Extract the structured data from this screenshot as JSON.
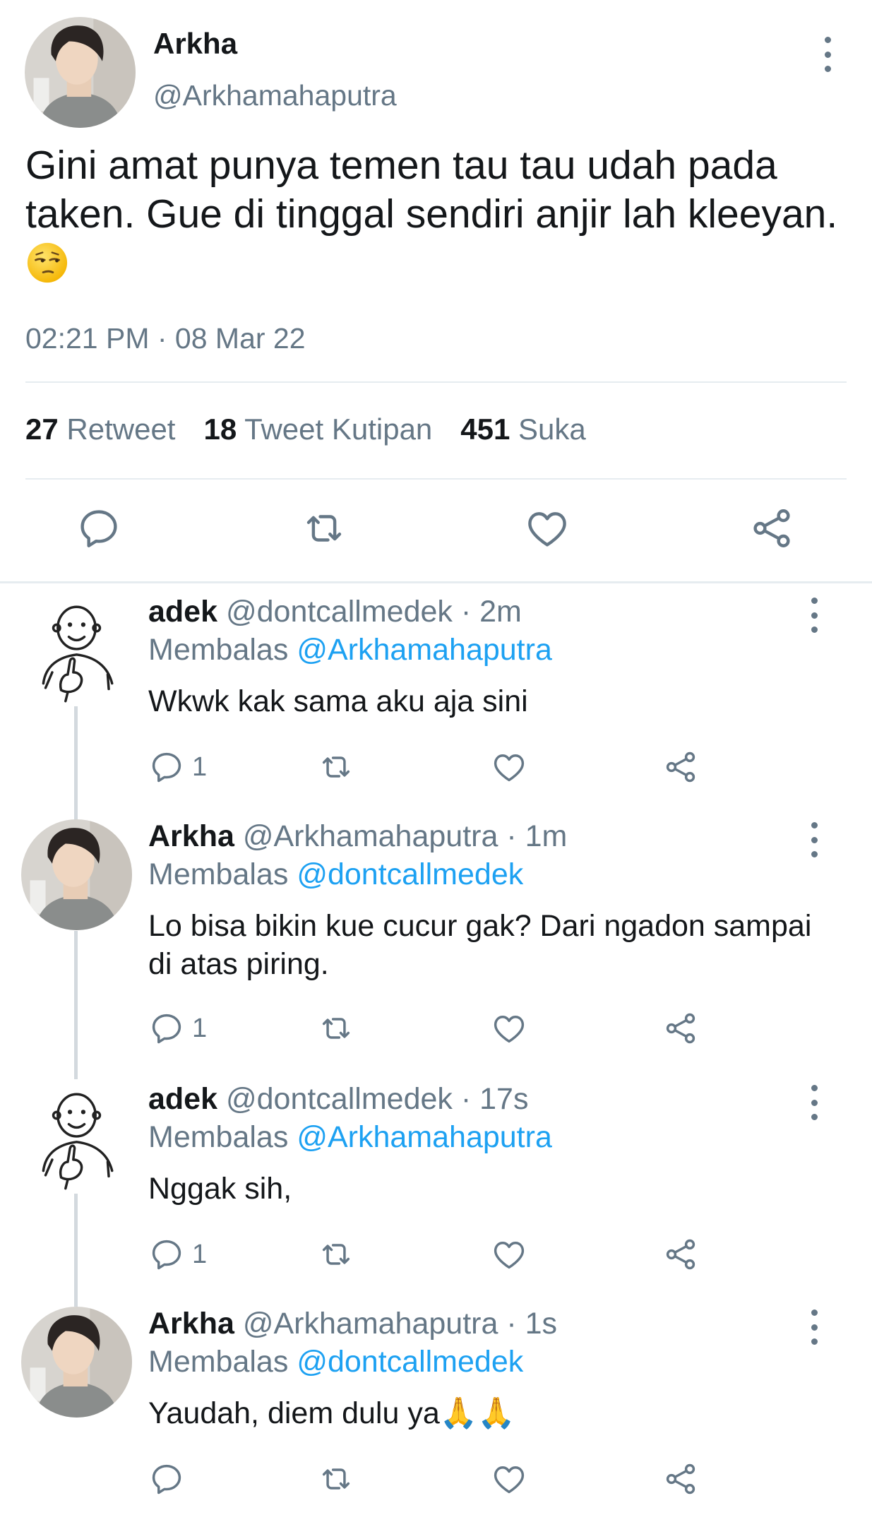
{
  "main_tweet": {
    "author_name": "Arkha",
    "author_handle": "@Arkhamahaputra",
    "text": "Gini amat punya temen tau tau udah pada taken. Gue di tinggal sendiri anjir lah kleeyan.",
    "emoji": "unamused-face-emoji",
    "timestamp": "02:21 PM · 08 Mar 22",
    "stats": {
      "retweets_count": "27",
      "retweets_label": "Retweet",
      "quotes_count": "18",
      "quotes_label": "Tweet Kutipan",
      "likes_count": "451",
      "likes_label": "Suka"
    },
    "actions": [
      "reply-icon",
      "retweet-icon",
      "like-icon",
      "share-icon"
    ]
  },
  "replies": [
    {
      "name": "adek",
      "handle": "@dontcallmedek",
      "time": "· 2m",
      "replying_label": "Membalas",
      "replying_to": "@Arkhamahaputra",
      "text": "Wkwk kak sama aku aja sini",
      "reply_count": "1"
    },
    {
      "name": "Arkha",
      "handle": "@Arkhamahaputra",
      "time": "· 1m",
      "replying_label": "Membalas",
      "replying_to": "@dontcallmedek",
      "text": "Lo bisa bikin kue cucur gak? Dari ngadon sampai di atas piring.",
      "reply_count": "1"
    },
    {
      "name": "adek",
      "handle": "@dontcallmedek",
      "time": "· 17s",
      "replying_label": "Membalas",
      "replying_to": "@Arkhamahaputra",
      "text": "Nggak sih,",
      "reply_count": "1"
    },
    {
      "name": "Arkha",
      "handle": "@Arkhamahaputra",
      "time": "· 1s",
      "replying_label": "Membalas",
      "replying_to": "@dontcallmedek",
      "text": "Yaudah, diem dulu ya🙏🙏",
      "reply_count": ""
    }
  ],
  "colors": {
    "text": "#14171a",
    "secondary": "#657786",
    "link": "#1da1f2",
    "divider": "#e6ecf0"
  }
}
